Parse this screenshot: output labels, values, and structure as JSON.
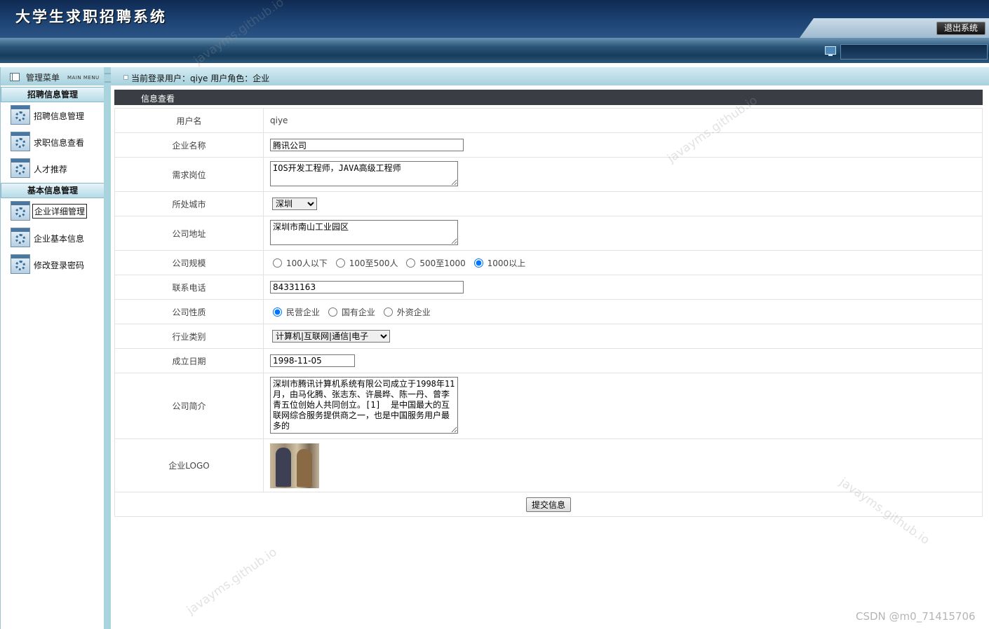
{
  "header": {
    "app_title": "大学生求职招聘系统",
    "logout_label": "退出系统"
  },
  "sidebar": {
    "menu_title": "管理菜单",
    "menu_subtitle": "MAIN MENU",
    "groups": [
      {
        "title": "招聘信息管理",
        "items": [
          {
            "label": "招聘信息管理"
          },
          {
            "label": "求职信息查看"
          },
          {
            "label": "人才推荐"
          }
        ]
      },
      {
        "title": "基本信息管理",
        "items": [
          {
            "label": "企业详细管理"
          },
          {
            "label": "企业基本信息"
          },
          {
            "label": "修改登录密码"
          }
        ]
      }
    ]
  },
  "topbar": {
    "user_info": "当前登录用户：qiye  用户角色：企业"
  },
  "panel": {
    "title": "信息查看"
  },
  "form": {
    "username": {
      "label": "用户名",
      "value": "qiye"
    },
    "company_name": {
      "label": "企业名称",
      "value": "腾讯公司"
    },
    "positions": {
      "label": "需求岗位",
      "value": "IOS开发工程师，JAVA高级工程师"
    },
    "city": {
      "label": "所处城市",
      "selected": "深圳"
    },
    "address": {
      "label": "公司地址",
      "value": "深圳市南山工业园区"
    },
    "scale": {
      "label": "公司规模",
      "options": [
        "100人以下",
        "100至500人",
        "500至1000",
        "1000以上"
      ],
      "selected_index": 3
    },
    "phone": {
      "label": "联系电话",
      "value": "84331163"
    },
    "nature": {
      "label": "公司性质",
      "options": [
        "民营企业",
        "国有企业",
        "外资企业"
      ],
      "selected_index": 0
    },
    "industry": {
      "label": "行业类别",
      "selected": "计算机|互联网|通信|电子"
    },
    "founded": {
      "label": "成立日期",
      "value": "1998-11-05"
    },
    "intro": {
      "label": "公司简介",
      "value": "深圳市腾讯计算机系统有限公司成立于1998年11月，由马化腾、张志东、许晨晔、陈一丹、曾李青五位创始人共同创立。[1]  是中国最大的互联网综合服务提供商之一，也是中国服务用户最多的"
    },
    "logo": {
      "label": "企业LOGO"
    },
    "submit_label": "提交信息"
  },
  "watermarks": [
    "javayms.github.io",
    "javayms.github.io",
    "javayms.github.io",
    "javayms.github.io"
  ],
  "credit": "CSDN @m0_71415706"
}
